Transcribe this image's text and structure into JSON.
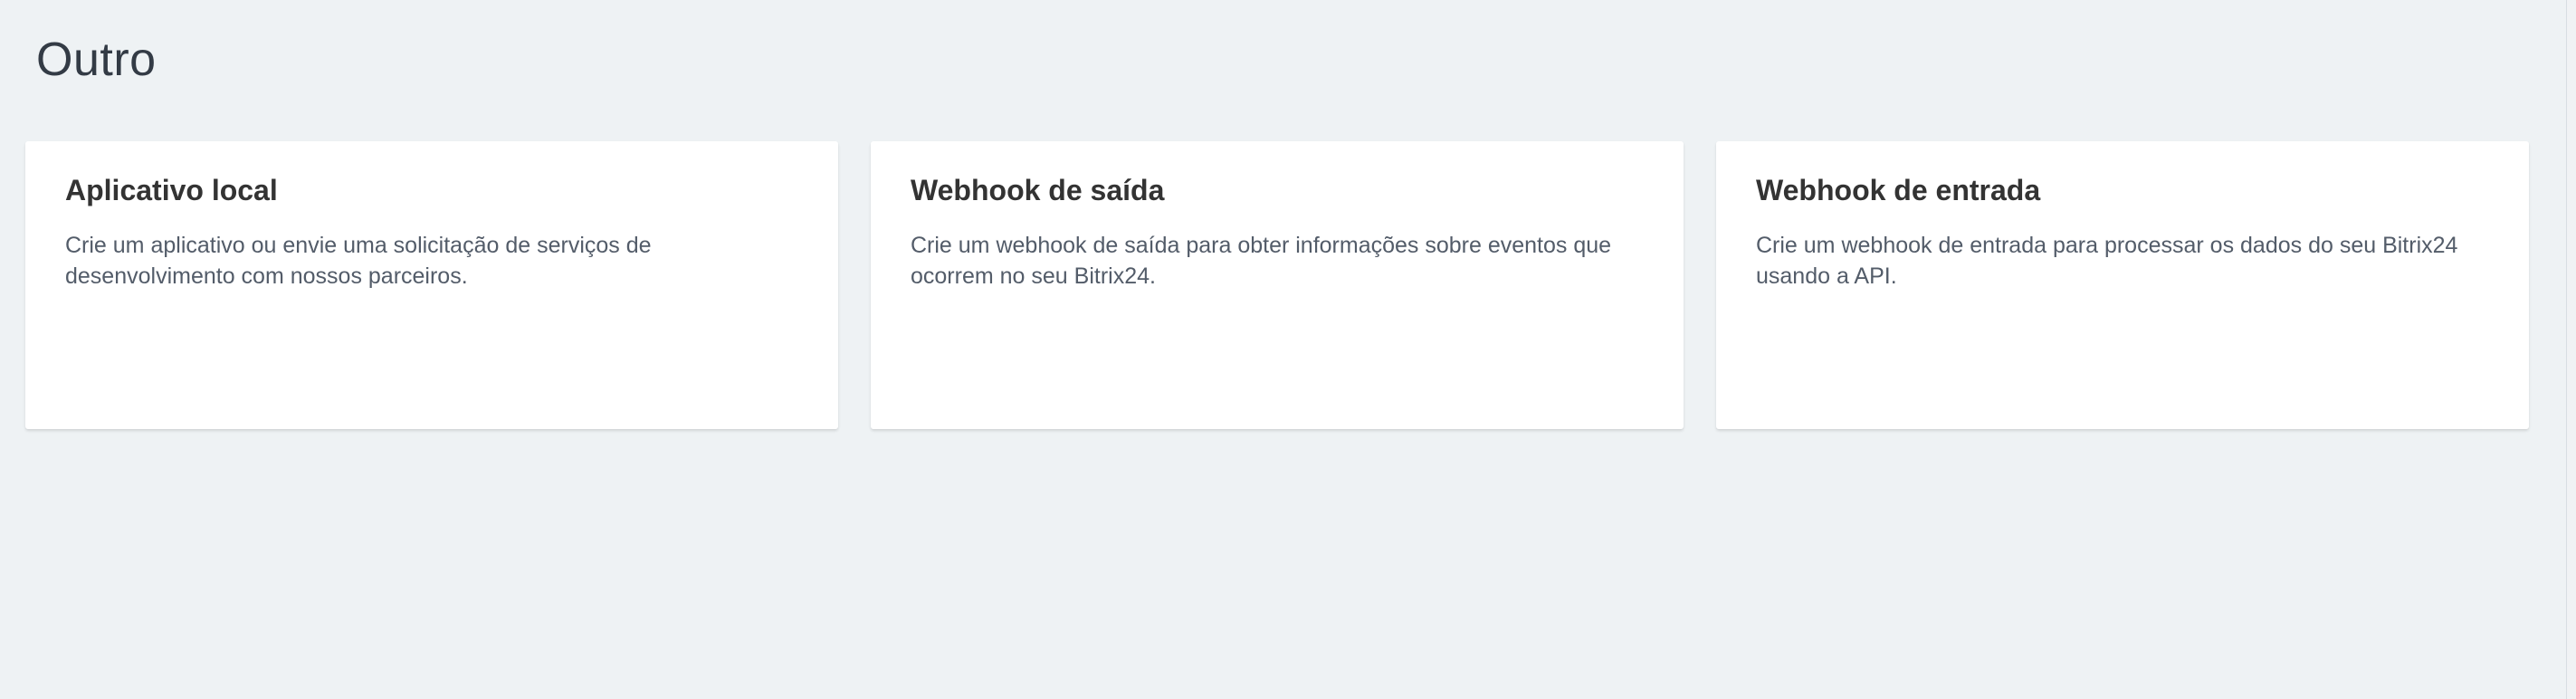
{
  "page": {
    "title": "Outro"
  },
  "cards": [
    {
      "title": "Aplicativo local",
      "description": "Crie um aplicativo ou envie uma solicitação de serviços de desenvolvimento com nossos parceiros."
    },
    {
      "title": "Webhook de saída",
      "description": "Crie um webhook de saída para obter informações sobre eventos que ocorrem no seu Bitrix24."
    },
    {
      "title": "Webhook de entrada",
      "description": "Crie um webhook de entrada para processar os dados do seu Bitrix24 usando a API."
    }
  ],
  "colors": {
    "background": "#eef2f4",
    "card": "#ffffff",
    "title_text": "#333333",
    "description_text": "#535c69"
  }
}
